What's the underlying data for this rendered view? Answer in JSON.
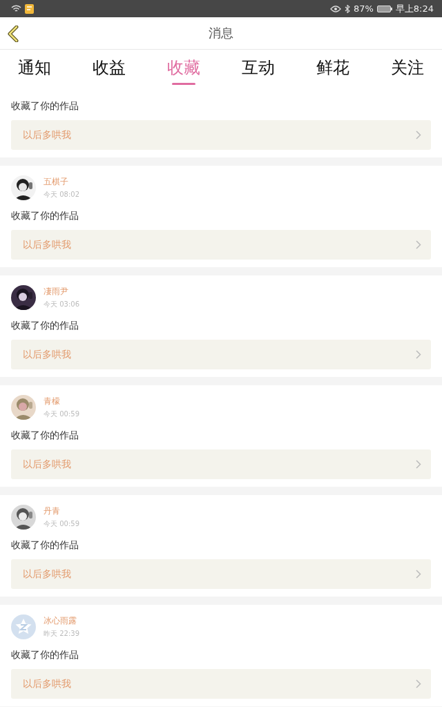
{
  "status_bar": {
    "battery": "87%",
    "time": "早上8:24"
  },
  "header": {
    "title": "消息"
  },
  "tabs": [
    {
      "label": "通知",
      "selected": false
    },
    {
      "label": "收益",
      "selected": false
    },
    {
      "label": "收藏",
      "selected": true
    },
    {
      "label": "互动",
      "selected": false
    },
    {
      "label": "鲜花",
      "selected": false
    },
    {
      "label": "关注",
      "selected": false
    }
  ],
  "messages": [
    {
      "kind": "partial",
      "action": "收藏了你的作品",
      "work": "以后多哄我"
    },
    {
      "kind": "full",
      "user": "五棋子",
      "time": "今天 08:02",
      "action": "收藏了你的作品",
      "work": "以后多哄我"
    },
    {
      "kind": "full",
      "user": "凄雨尹",
      "time": "今天 03:06",
      "action": "收藏了你的作品",
      "work": "以后多哄我"
    },
    {
      "kind": "full",
      "user": "青檬",
      "time": "今天 00:59",
      "action": "收藏了你的作品",
      "work": "以后多哄我"
    },
    {
      "kind": "full",
      "user": "丹青",
      "time": "今天 00:59",
      "action": "收藏了你的作品",
      "work": "以后多哄我"
    },
    {
      "kind": "full",
      "avatar": {
        "kind": "default"
      },
      "user": "冰心雨露",
      "time": "昨天 22:39",
      "action": "收藏了你的作品",
      "work": "以后多哄我"
    }
  ]
}
